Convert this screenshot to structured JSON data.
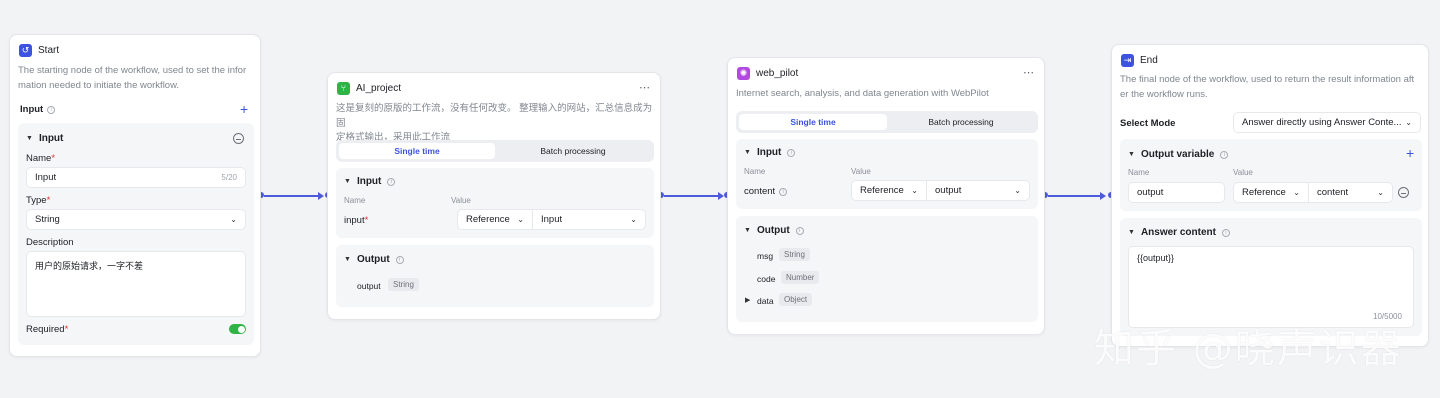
{
  "start": {
    "title": "Start",
    "desc1": "The starting node of the workflow, used to set the infor",
    "desc2": "mation needed to initiate the workflow.",
    "input_label": "Input",
    "section_title": "Input",
    "name_label": "Name",
    "name_value": "Input",
    "name_count": "5/20",
    "type_label": "Type",
    "type_value": "String",
    "description_label": "Description",
    "description_value": "用户的原始请求，一字不差",
    "required_label": "Required",
    "required_on": true
  },
  "ai_project": {
    "title": "AI_project",
    "desc1": "这是复刻的原版的工作流，没有任何改变。 整理输入的网站，汇总信息成为固",
    "desc2": "定格式输出，采用此工作流",
    "tab_single": "Single time",
    "tab_batch": "Batch processing",
    "input_title": "Input",
    "col_name": "Name",
    "col_value": "Value",
    "param_name": "input",
    "ref_label": "Reference",
    "ref_value": "Input",
    "output_title": "Output",
    "out_name": "output",
    "out_type": "String"
  },
  "web_pilot": {
    "title": "web_pilot",
    "desc": "Internet search, analysis, and data generation with WebPilot",
    "tab_single": "Single time",
    "tab_batch": "Batch processing",
    "input_title": "Input",
    "col_name": "Name",
    "col_value": "Value",
    "param_name": "content",
    "ref_label": "Reference",
    "ref_value": "output",
    "output_title": "Output",
    "outputs": [
      {
        "name": "msg",
        "type": "String"
      },
      {
        "name": "code",
        "type": "Number"
      },
      {
        "name": "data",
        "type": "Object"
      }
    ]
  },
  "end": {
    "title": "End",
    "desc1": "The final node of the workflow, used to return the result information aft",
    "desc2": "er the workflow runs.",
    "select_mode_label": "Select Mode",
    "select_mode_value": "Answer directly using Answer Conte...",
    "output_var_title": "Output variable",
    "col_name": "Name",
    "col_value": "Value",
    "var_name": "output",
    "ref_label": "Reference",
    "ref_value": "content",
    "answer_title": "Answer content",
    "answer_value": "{{output}}",
    "answer_count": "10/5000"
  },
  "more_icon": "⋯",
  "accent": "#3c52e0",
  "edge_color": "#4d5bd9",
  "watermark": "知乎 @晓声识器"
}
